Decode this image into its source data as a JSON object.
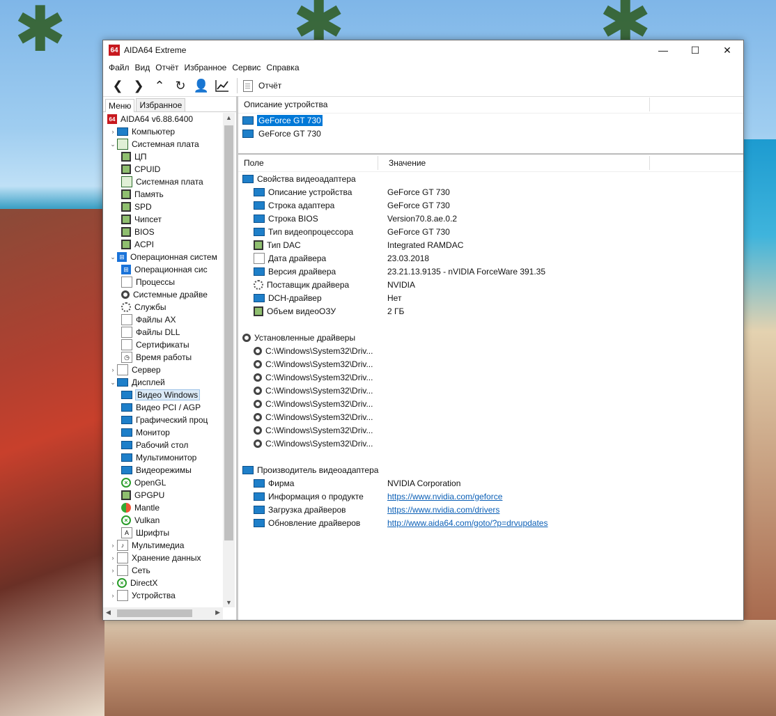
{
  "window": {
    "title": "AIDA64 Extreme",
    "controls": {
      "minimize": "—",
      "maximize": "☐",
      "close": "✕"
    }
  },
  "menu": [
    "Файл",
    "Вид",
    "Отчёт",
    "Избранное",
    "Сервис",
    "Справка"
  ],
  "toolbar": {
    "buttons": [
      "back",
      "forward",
      "up",
      "refresh",
      "user",
      "chart"
    ],
    "report_label": "Отчёт"
  },
  "tabs": {
    "menu": "Меню",
    "favorites": "Избранное"
  },
  "tree": {
    "root": "AIDA64 v6.88.6400",
    "items": [
      {
        "label": "Компьютер",
        "level": 1,
        "arrow": "›",
        "icon": "monitor-icon"
      },
      {
        "label": "Системная плата",
        "level": 1,
        "arrow": "⌄",
        "icon": "motherboard-icon"
      },
      {
        "label": "ЦП",
        "level": 2,
        "icon": "cpu-icon"
      },
      {
        "label": "CPUID",
        "level": 2,
        "icon": "cpu-icon"
      },
      {
        "label": "Системная плата",
        "level": 2,
        "icon": "motherboard-icon"
      },
      {
        "label": "Память",
        "level": 2,
        "icon": "memory-icon"
      },
      {
        "label": "SPD",
        "level": 2,
        "icon": "memory-icon"
      },
      {
        "label": "Чипсет",
        "level": 2,
        "icon": "chip-icon"
      },
      {
        "label": "BIOS",
        "level": 2,
        "icon": "chip-icon"
      },
      {
        "label": "ACPI",
        "level": 2,
        "icon": "chip-icon"
      },
      {
        "label": "Операционная систем",
        "level": 1,
        "arrow": "⌄",
        "icon": "windows-icon"
      },
      {
        "label": "Операционная сис",
        "level": 2,
        "icon": "windows-icon"
      },
      {
        "label": "Процессы",
        "level": 2,
        "icon": "process-icon"
      },
      {
        "label": "Системные драйве",
        "level": 2,
        "icon": "driver-icon"
      },
      {
        "label": "Службы",
        "level": 2,
        "icon": "gear-icon"
      },
      {
        "label": "Файлы AX",
        "level": 2,
        "icon": "file-icon"
      },
      {
        "label": "Файлы DLL",
        "level": 2,
        "icon": "file-icon"
      },
      {
        "label": "Сертификаты",
        "level": 2,
        "icon": "certificate-icon"
      },
      {
        "label": "Время работы",
        "level": 2,
        "icon": "clock-icon"
      },
      {
        "label": "Сервер",
        "level": 1,
        "arrow": "›",
        "icon": "server-icon"
      },
      {
        "label": "Дисплей",
        "level": 1,
        "arrow": "⌄",
        "icon": "monitor-icon"
      },
      {
        "label": "Видео Windows",
        "level": 2,
        "icon": "monitor-icon",
        "selected": true
      },
      {
        "label": "Видео PCI / AGP",
        "level": 2,
        "icon": "monitor-icon"
      },
      {
        "label": "Графический проц",
        "level": 2,
        "icon": "monitor-icon"
      },
      {
        "label": "Монитор",
        "level": 2,
        "icon": "monitor-icon"
      },
      {
        "label": "Рабочий стол",
        "level": 2,
        "icon": "monitor-icon"
      },
      {
        "label": "Мультимонитор",
        "level": 2,
        "icon": "monitor-icon"
      },
      {
        "label": "Видеорежимы",
        "level": 2,
        "icon": "monitor-icon"
      },
      {
        "label": "OpenGL",
        "level": 2,
        "icon": "xbox-icon"
      },
      {
        "label": "GPGPU",
        "level": 2,
        "icon": "chip-icon"
      },
      {
        "label": "Mantle",
        "level": 2,
        "icon": "mantle-icon"
      },
      {
        "label": "Vulkan",
        "level": 2,
        "icon": "xbox-icon"
      },
      {
        "label": "Шрифты",
        "level": 2,
        "icon": "font-icon"
      },
      {
        "label": "Мультимедиа",
        "level": 1,
        "arrow": "›",
        "icon": "speaker-icon"
      },
      {
        "label": "Хранение данных",
        "level": 1,
        "arrow": "›",
        "icon": "disk-icon"
      },
      {
        "label": "Сеть",
        "level": 1,
        "arrow": "›",
        "icon": "network-icon"
      },
      {
        "label": "DirectX",
        "level": 1,
        "arrow": "›",
        "icon": "xbox-icon"
      },
      {
        "label": "Устройства",
        "level": 1,
        "arrow": "›",
        "icon": "device-icon"
      }
    ]
  },
  "device_pane": {
    "header": "Описание устройства",
    "devices": [
      {
        "label": "GeForce GT 730",
        "selected": true
      },
      {
        "label": "GeForce GT 730",
        "selected": false
      }
    ]
  },
  "details": {
    "col_field": "Поле",
    "col_value": "Значение",
    "sections": [
      {
        "title": "Свойства видеоадаптера",
        "icon": "monitor-icon",
        "rows": [
          {
            "field": "Описание устройства",
            "value": "GeForce GT 730",
            "icon": "monitor-icon"
          },
          {
            "field": "Строка адаптера",
            "value": "GeForce GT 730",
            "icon": "monitor-icon"
          },
          {
            "field": "Строка BIOS",
            "value": "Version70.8.ae.0.2",
            "icon": "monitor-icon"
          },
          {
            "field": "Тип видеопроцессора",
            "value": "GeForce GT 730",
            "icon": "monitor-icon"
          },
          {
            "field": "Тип DAC",
            "value": "Integrated RAMDAC",
            "icon": "chip-icon"
          },
          {
            "field": "Дата драйвера",
            "value": "23.03.2018",
            "icon": "calendar-icon"
          },
          {
            "field": "Версия драйвера",
            "value": "23.21.13.9135 - nVIDIA ForceWare 391.35",
            "icon": "monitor-icon"
          },
          {
            "field": "Поставщик драйвера",
            "value": "NVIDIA",
            "icon": "gear-icon"
          },
          {
            "field": "DCH-драйвер",
            "value": "Нет",
            "icon": "monitor-icon"
          },
          {
            "field": "Объем видеоОЗУ",
            "value": "2 ГБ",
            "icon": "memory-icon"
          }
        ]
      },
      {
        "title": "Установленные драйверы",
        "icon": "cd-icon",
        "rows": [
          {
            "field": "C:\\Windows\\System32\\Driv...",
            "value": "",
            "icon": "cd-icon"
          },
          {
            "field": "C:\\Windows\\System32\\Driv...",
            "value": "",
            "icon": "cd-icon"
          },
          {
            "field": "C:\\Windows\\System32\\Driv...",
            "value": "",
            "icon": "cd-icon"
          },
          {
            "field": "C:\\Windows\\System32\\Driv...",
            "value": "",
            "icon": "cd-icon"
          },
          {
            "field": "C:\\Windows\\System32\\Driv...",
            "value": "",
            "icon": "cd-icon"
          },
          {
            "field": "C:\\Windows\\System32\\Driv...",
            "value": "",
            "icon": "cd-icon"
          },
          {
            "field": "C:\\Windows\\System32\\Driv...",
            "value": "",
            "icon": "cd-icon"
          },
          {
            "field": "C:\\Windows\\System32\\Driv...",
            "value": "",
            "icon": "cd-icon"
          }
        ]
      },
      {
        "title": "Производитель видеоадаптера",
        "icon": "monitor-icon",
        "rows": [
          {
            "field": "Фирма",
            "value": "NVIDIA Corporation",
            "icon": "monitor-icon",
            "link": false
          },
          {
            "field": "Информация о продукте",
            "value": "https://www.nvidia.com/geforce",
            "icon": "monitor-icon",
            "link": true
          },
          {
            "field": "Загрузка драйверов",
            "value": "https://www.nvidia.com/drivers",
            "icon": "monitor-icon",
            "link": true
          },
          {
            "field": "Обновление драйверов",
            "value": "http://www.aida64.com/goto/?p=drvupdates",
            "icon": "monitor-icon",
            "link": true
          }
        ]
      }
    ]
  }
}
